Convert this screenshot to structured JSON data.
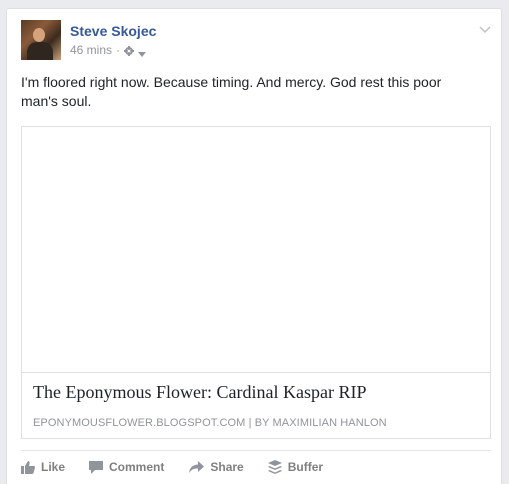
{
  "post": {
    "author": "Steve Skojec",
    "time": "46 mins",
    "separator": "·",
    "status_text": "I'm floored right now. Because timing. And mercy. God rest this poor man's soul."
  },
  "link_preview": {
    "title": "The Eponymous Flower: Cardinal Kaspar RIP",
    "caption": "EPONYMOUSFLOWER.BLOGSPOT.COM  |  BY MAXIMILIAN HANLON"
  },
  "actions": {
    "like": "Like",
    "comment": "Comment",
    "share": "Share",
    "buffer": "Buffer"
  },
  "colors": {
    "author": "#365899",
    "meta": "#90949c",
    "action": "#7f7f7f"
  },
  "icons": [
    "gear-icon",
    "caret-down-icon",
    "chevron-down-icon",
    "like-icon",
    "comment-icon",
    "share-icon",
    "buffer-icon"
  ]
}
